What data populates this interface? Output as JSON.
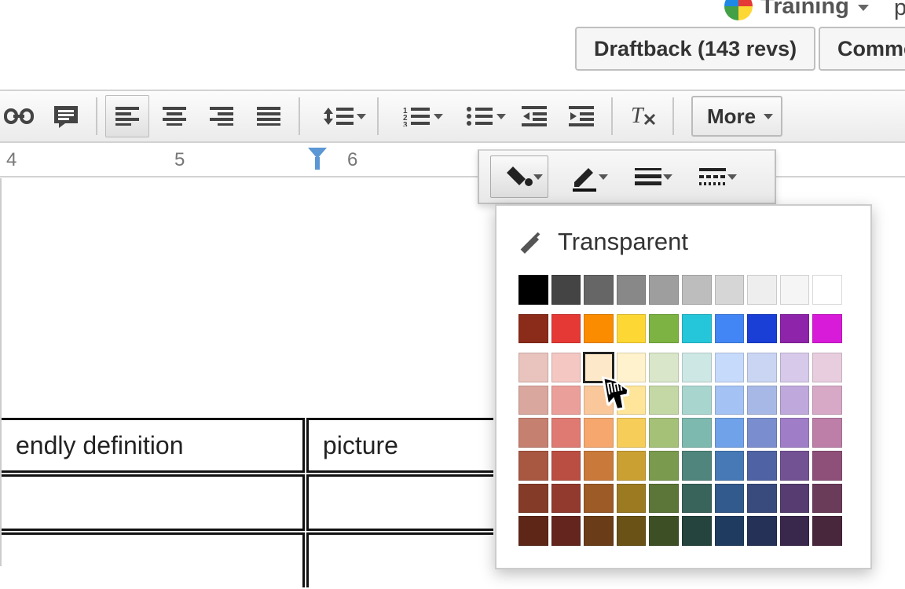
{
  "account": {
    "name": "Training",
    "extra": "p"
  },
  "buttons": {
    "draftback": "Draftback (143 revs)",
    "comments": "Comme"
  },
  "toolbar": {
    "more": "More"
  },
  "ruler": {
    "marks": [
      "4",
      "5",
      "6"
    ]
  },
  "popup": {
    "transparent": "Transparent"
  },
  "table": {
    "col1": "endly definition",
    "col2": "picture"
  },
  "palette": {
    "row_grey": [
      "#000000",
      "#444444",
      "#666666",
      "#888888",
      "#9e9e9e",
      "#bdbdbd",
      "#d6d6d6",
      "#eeeeee",
      "#f5f5f5",
      "#ffffff"
    ],
    "row_main": [
      "#8b2b1a",
      "#e53935",
      "#fb8c00",
      "#fdd835",
      "#7cb342",
      "#26c6da",
      "#4285f4",
      "#1a3fd6",
      "#8e24aa",
      "#d81bd8"
    ],
    "shade_rows": [
      [
        "#e9c3bd",
        "#f4c7c3",
        "#fde0c8",
        "#fff2cc",
        "#d9e6c9",
        "#cde8e4",
        "#c6dafc",
        "#c9d5f2",
        "#d6c9ea",
        "#e8cddf"
      ],
      [
        "#d9a79e",
        "#eb9f9a",
        "#f9c79a",
        "#ffe599",
        "#c3d8a5",
        "#a8d6cf",
        "#a4c2f4",
        "#a8b8e6",
        "#bfa8db",
        "#d7a9c7"
      ],
      [
        "#c6806f",
        "#de7a72",
        "#f5a76d",
        "#f7cd5a",
        "#a5c178",
        "#7db9af",
        "#6fa2e8",
        "#7a8ecf",
        "#9f7dc7",
        "#bd7ea8"
      ],
      [
        "#a85741",
        "#bb4e42",
        "#c97a3a",
        "#caa033",
        "#7a9a4e",
        "#4f857c",
        "#4679b6",
        "#4f63a4",
        "#735294",
        "#8e5078"
      ],
      [
        "#843b27",
        "#933a2f",
        "#9c5b27",
        "#9c7a22",
        "#5c7538",
        "#38645c",
        "#325a8c",
        "#394a7d",
        "#563c70",
        "#6b3b5a"
      ],
      [
        "#5d2617",
        "#63251d",
        "#6a3c17",
        "#6a5216",
        "#3d4f24",
        "#24443d",
        "#1f3c60",
        "#253156",
        "#3a274c",
        "#48263c"
      ]
    ]
  }
}
